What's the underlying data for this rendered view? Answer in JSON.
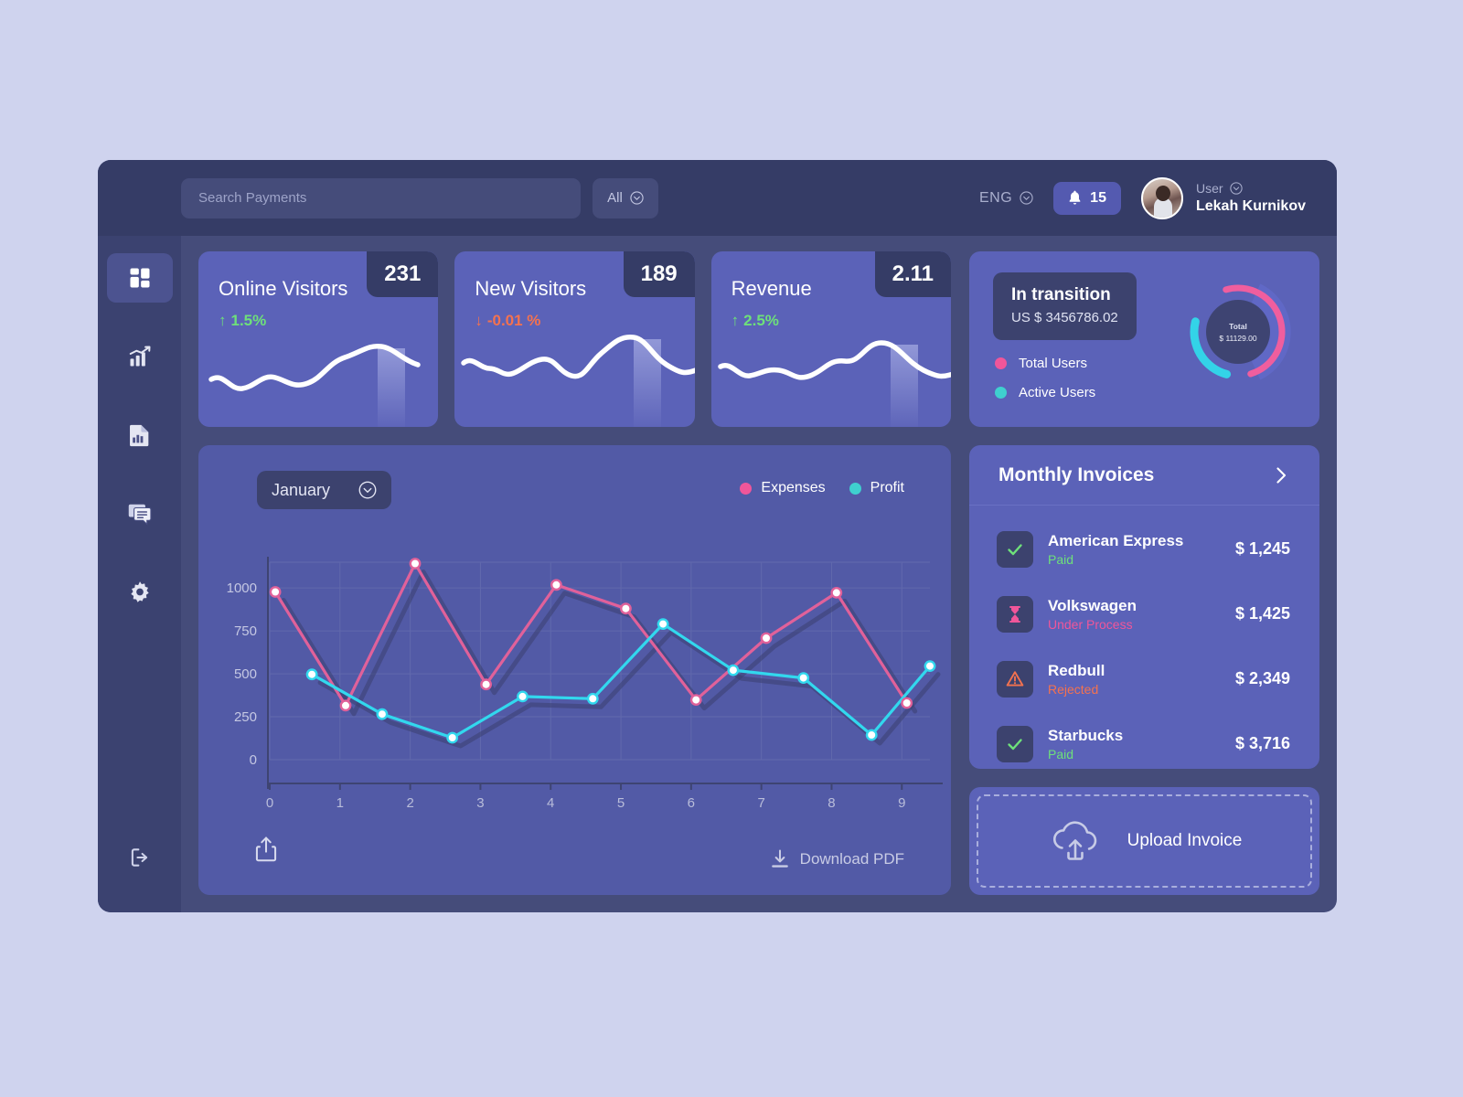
{
  "header": {
    "search_placeholder": "Search Payments",
    "search_value": "",
    "filter_label": "All",
    "language": "ENG",
    "notification_count": "15",
    "user_role": "User",
    "user_name": "Lekah Kurnikov"
  },
  "sidebar": {
    "items": [
      {
        "name": "dashboard",
        "label": "Dashboard"
      },
      {
        "name": "analytics",
        "label": "Analytics"
      },
      {
        "name": "reports",
        "label": "Reports"
      },
      {
        "name": "messages",
        "label": "Messages"
      },
      {
        "name": "settings",
        "label": "Settings"
      }
    ],
    "logout_label": "Logout"
  },
  "stats": [
    {
      "title": "Online Visitors",
      "value": "231",
      "delta": "1.5%",
      "direction": "up",
      "arrow": "↑"
    },
    {
      "title": "New Visitors",
      "value": "189",
      "delta": "-0.01 %",
      "direction": "down",
      "arrow": "↓"
    },
    {
      "title": "Revenue",
      "value": "2.11",
      "delta": "2.5%",
      "direction": "up",
      "arrow": "↑"
    }
  ],
  "transition": {
    "title": "In transition",
    "amount": "US $ 3456786.02",
    "legend": [
      {
        "label": "Total Users",
        "color": "#f0569a"
      },
      {
        "label": "Active Users",
        "color": "#3fd0cf"
      }
    ],
    "donut_center_label": "Total",
    "donut_center_value": "$ 11129.00"
  },
  "chart_panel": {
    "month": "January",
    "share_label": "Share",
    "download_label": "Download PDF"
  },
  "chart_data": {
    "type": "line",
    "title": "",
    "xlabel": "",
    "ylabel": "",
    "xlim": [
      0,
      9.4
    ],
    "ylim": [
      0,
      1150
    ],
    "x_ticks": [
      0,
      1,
      2,
      3,
      4,
      5,
      6,
      7,
      8,
      9
    ],
    "y_ticks": [
      0,
      250,
      500,
      750,
      1000
    ],
    "grid": true,
    "legend_position": "top-right",
    "series": [
      {
        "name": "Expenses",
        "color": "#e0619a",
        "x": [
          0.08,
          1.08,
          2.07,
          3.08,
          4.08,
          5.07,
          6.07,
          7.07,
          8.07,
          9.07
        ],
        "values": [
          977,
          315,
          1142,
          438,
          1018,
          880,
          348,
          708,
          972,
          330
        ]
      },
      {
        "name": "Profit",
        "color": "#32d8ee",
        "x": [
          0.6,
          1.6,
          2.6,
          3.6,
          4.6,
          5.6,
          6.6,
          7.6,
          8.57,
          9.4
        ],
        "values": [
          497,
          265,
          128,
          368,
          355,
          790,
          521,
          476,
          144,
          545
        ]
      }
    ]
  },
  "invoices": {
    "title": "Monthly Invoices",
    "rows": [
      {
        "name": "American Express",
        "status": "Paid",
        "status_type": "paid",
        "amount": "$ 1,245",
        "icon": "check-icon"
      },
      {
        "name": "Volkswagen",
        "status": "Under Process",
        "status_type": "process",
        "amount": "$ 1,425",
        "icon": "hourglass-icon"
      },
      {
        "name": "Redbull",
        "status": "Rejected",
        "status_type": "rejected",
        "amount": "$ 2,349",
        "icon": "warning-icon"
      },
      {
        "name": "Starbucks",
        "status": "Paid",
        "status_type": "paid",
        "amount": "$ 3,716",
        "icon": "check-icon"
      }
    ]
  },
  "upload": {
    "label": "Upload Invoice"
  },
  "colors": {
    "app_bg": "#454c7a",
    "header_bg": "#353c66",
    "sidebar_bg": "#3b4270",
    "card_bg": "#5b62b8",
    "panel_bg": "#525aa6",
    "accent_pink": "#f0569a",
    "accent_cyan": "#3fd0cf",
    "positive": "#6ee07a",
    "negative": "#f4724f"
  }
}
